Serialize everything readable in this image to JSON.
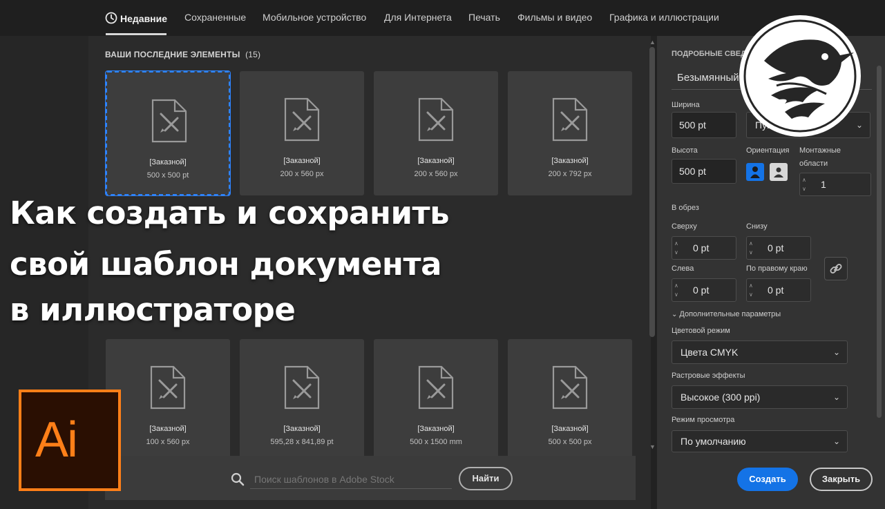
{
  "tabs": [
    {
      "label": "Недавние",
      "active": true
    },
    {
      "label": "Сохраненные"
    },
    {
      "label": "Мобильное устройство"
    },
    {
      "label": "Для Интернета"
    },
    {
      "label": "Печать"
    },
    {
      "label": "Фильмы и видео"
    },
    {
      "label": "Графика и иллюстрации"
    }
  ],
  "recent": {
    "title": "ВАШИ ПОСЛЕДНИЕ ЭЛЕМЕНТЫ",
    "count": "(15)",
    "cards": [
      {
        "name": "[Заказной]",
        "size": "500 x 500 pt",
        "selected": true
      },
      {
        "name": "[Заказной]",
        "size": "200 x 560 px"
      },
      {
        "name": "[Заказной]",
        "size": "200 x 560 px"
      },
      {
        "name": "[Заказной]",
        "size": "200 x 792 px"
      },
      {
        "name": "[Заказной]",
        "size": "100 x 560 px"
      },
      {
        "name": "[Заказной]",
        "size": "595,28 x 841,89 pt"
      },
      {
        "name": "[Заказной]",
        "size": "500 x 1500 mm"
      },
      {
        "name": "[Заказной]",
        "size": "500 x 500 px"
      }
    ]
  },
  "search": {
    "placeholder": "Поиск шаблонов в Adobe Stock",
    "button": "Найти"
  },
  "headline": [
    "Как создать и сохранить",
    "свой шаблон документа",
    "в иллюстраторе"
  ],
  "logo": {
    "text": "Ai"
  },
  "details": {
    "title": "ПОДРОБНЫЕ СВЕДЕНИЯ О СТИЛЕ",
    "doc_name": "Безымянный-2",
    "width_label": "Ширина",
    "width": "500 pt",
    "units": "Пункты",
    "height_label": "Высота",
    "height": "500 pt",
    "orientation_label": "Ориентация",
    "artboards_label_1": "Монтажные",
    "artboards_label_2": "области",
    "artboards": "1",
    "bleed_label": "В обрез",
    "top_label": "Сверху",
    "top": "0 pt",
    "bottom_label": "Снизу",
    "bottom": "0 pt",
    "left_label": "Слева",
    "left": "0 pt",
    "right_label": "По правому краю",
    "right": "0 pt",
    "advanced": "Дополнительные параметры",
    "color_mode_label": "Цветовой режим",
    "color_mode": "Цвета CMYK",
    "raster_label": "Растровые эффекты",
    "raster": "Высокое (300 ppi)",
    "preview_label": "Режим просмотра",
    "preview": "По умолчанию",
    "create": "Создать",
    "close": "Закрыть"
  },
  "colors": {
    "accent": "#1473e6",
    "logo": "#ff7f18",
    "selection": "#2d83ff"
  }
}
